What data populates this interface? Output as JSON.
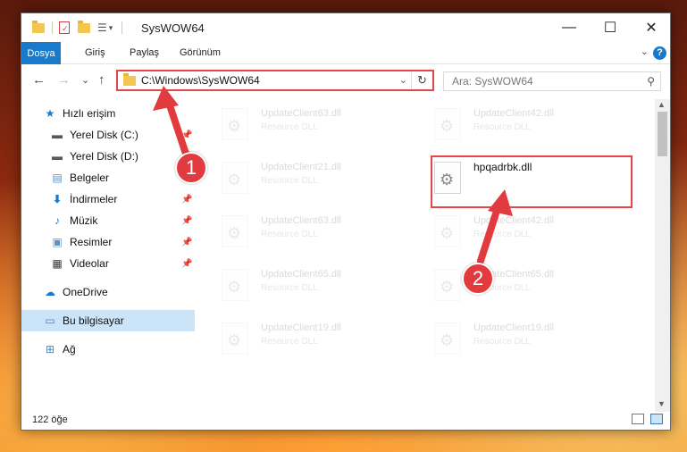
{
  "window": {
    "title": "SysWOW64",
    "minimize": "—",
    "maximize": "☐",
    "close": "✕"
  },
  "ribbon": {
    "tabs": [
      "Dosya",
      "Giriş",
      "Paylaş",
      "Görünüm"
    ]
  },
  "navigation": {
    "back": "←",
    "forward": "→",
    "recent": "⌄",
    "up": "↑",
    "address": "C:\\Windows\\SysWOW64",
    "refresh": "↻",
    "search_placeholder": "Ara: SysWOW64"
  },
  "sidebar": {
    "items": [
      {
        "label": "Hızlı erişim",
        "icon": "star-icon"
      },
      {
        "label": "Yerel Disk (C:)",
        "icon": "drive-icon"
      },
      {
        "label": "Yerel Disk (D:)",
        "icon": "drive-icon"
      },
      {
        "label": "Belgeler",
        "icon": "documents-icon"
      },
      {
        "label": "İndirmeler",
        "icon": "downloads-icon"
      },
      {
        "label": "Müzik",
        "icon": "music-icon"
      },
      {
        "label": "Resimler",
        "icon": "pictures-icon"
      },
      {
        "label": "Videolar",
        "icon": "videos-icon"
      },
      {
        "label": "OneDrive",
        "icon": "onedrive-icon"
      },
      {
        "label": "Bu bilgisayar",
        "icon": "computer-icon"
      },
      {
        "label": "Ağ",
        "icon": "network-icon"
      }
    ]
  },
  "files": [
    {
      "name": "UpdateClient63.dll",
      "type": "Resource DLL"
    },
    {
      "name": "UpdateClient42.dll",
      "type": "Resource DLL"
    },
    {
      "name": "UpdateClient21.dll",
      "type": "Resource DLL"
    },
    {
      "name": "hpqadrbk.dll",
      "type": ""
    },
    {
      "name": "UpdateClient63.dll",
      "type": "Resource DLL"
    },
    {
      "name": "UpdateClient42.dll",
      "type": "Resource DLL"
    },
    {
      "name": "UpdateClient65.dll",
      "type": "Resource DLL"
    },
    {
      "name": "UpdateClient65.dll",
      "type": "Resource DLL"
    },
    {
      "name": "UpdateClient19.dll",
      "type": "Resource DLL"
    },
    {
      "name": "UpdateClient19.dll",
      "type": "Resource DLL"
    }
  ],
  "status": {
    "count": "122 öğe"
  },
  "callouts": {
    "one": "1",
    "two": "2"
  },
  "colors": {
    "accent": "#1979ca",
    "highlight": "#e5464a",
    "callout": "#e23b3f"
  }
}
